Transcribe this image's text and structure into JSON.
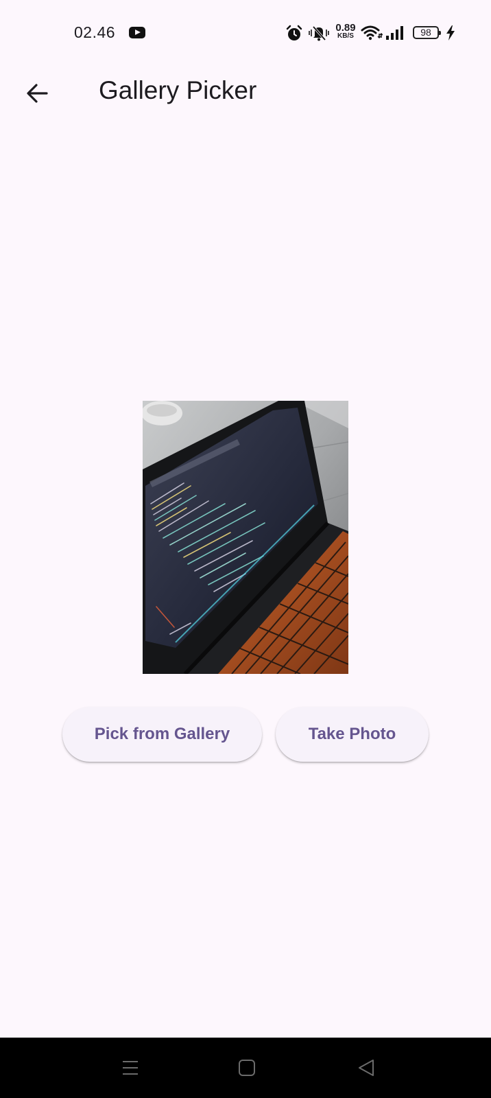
{
  "status_bar": {
    "time": "02.46",
    "net_speed_value": "0.89",
    "net_speed_unit": "KB/S",
    "battery_level": "98",
    "icons": [
      "youtube-icon",
      "alarm-icon",
      "mute-icon",
      "wifi-icon",
      "signal-icon",
      "battery-icon",
      "charging-icon"
    ]
  },
  "app_bar": {
    "title": "Gallery Picker",
    "back_icon": "arrow-back-icon"
  },
  "actions": {
    "pick_gallery_label": "Pick from Gallery",
    "take_photo_label": "Take Photo"
  },
  "nav_bar": {
    "icons": [
      "menu-icon",
      "home-icon",
      "back-triangle-icon"
    ]
  },
  "colors": {
    "background": "#fdf7fd",
    "button_bg": "#f7f2fa",
    "button_text": "#65558f",
    "text": "#1d1b20",
    "nav_bar": "#000000"
  }
}
